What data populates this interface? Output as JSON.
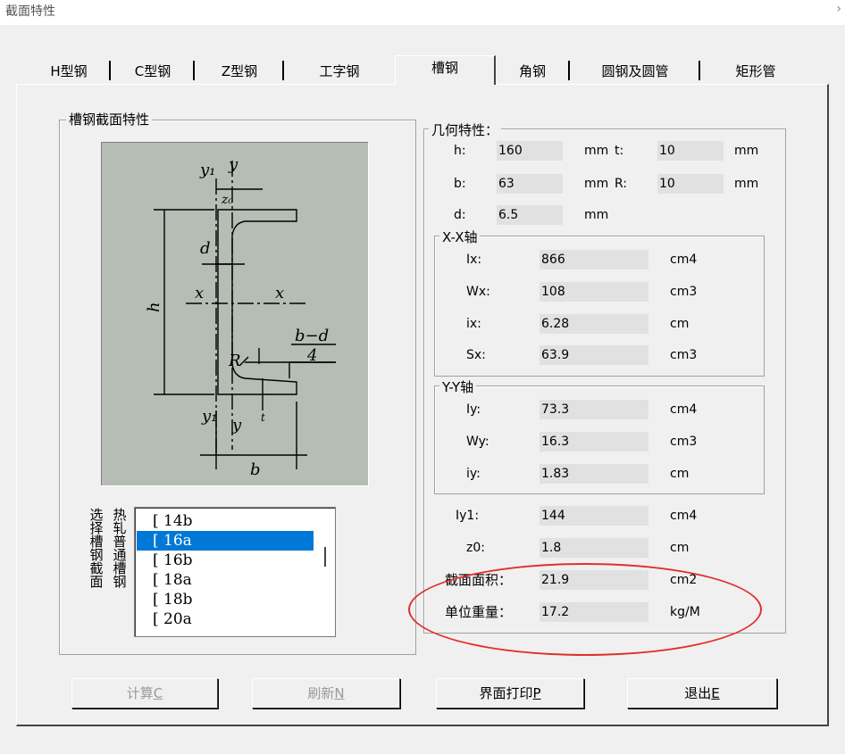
{
  "window": {
    "title": "截面特性",
    "close_glyph": "›"
  },
  "tabs": [
    {
      "label": "H型钢",
      "active": false
    },
    {
      "label": "C型钢",
      "active": false
    },
    {
      "label": "Z型钢",
      "active": false
    },
    {
      "label": "工字钢",
      "active": false
    },
    {
      "label": "槽钢",
      "active": true
    },
    {
      "label": "角钢",
      "active": false
    },
    {
      "label": "圆钢及圆管",
      "active": false
    },
    {
      "label": "矩形管",
      "active": false
    }
  ],
  "section_group": {
    "title": "槽钢截面特性"
  },
  "diagram": {
    "labels": {
      "y1_top": "y₁",
      "y_top": "y",
      "z0": "z₀",
      "d": "d",
      "x_left": "x",
      "x_right": "x",
      "h": "h",
      "bd_num": "b−d",
      "bd_den": "4",
      "R": "R",
      "y1_bottom": "y₁",
      "y_bottom": "y",
      "t": "t",
      "b": "b"
    }
  },
  "list_label": {
    "col1": "选择槽钢截面",
    "col2": "热轧普通槽钢"
  },
  "steel_list": {
    "items": [
      "[ 14b",
      "[ 16a",
      "[ 16b",
      "[ 18a",
      "[ 18b",
      "[ 20a"
    ],
    "selected_index": 1
  },
  "geometry": {
    "title": "几何特性：",
    "h": {
      "label": "h:",
      "value": "160",
      "unit": "mm"
    },
    "t": {
      "label": "t:",
      "value": "10",
      "unit": "mm"
    },
    "b": {
      "label": "b:",
      "value": "63",
      "unit": "mm"
    },
    "R": {
      "label": "R:",
      "value": "10",
      "unit": "mm"
    },
    "d": {
      "label": "d:",
      "value": "6.5",
      "unit": "mm"
    }
  },
  "xx_axis": {
    "title": "X-X轴",
    "rows": [
      {
        "label": "Ix:",
        "value": "866",
        "unit": "cm4"
      },
      {
        "label": "Wx:",
        "value": "108",
        "unit": "cm3"
      },
      {
        "label": "ix:",
        "value": "6.28",
        "unit": "cm"
      },
      {
        "label": "Sx:",
        "value": "63.9",
        "unit": "cm3"
      }
    ]
  },
  "yy_axis": {
    "title": "Y-Y轴",
    "rows": [
      {
        "label": "Iy:",
        "value": "73.3",
        "unit": "cm4"
      },
      {
        "label": "Wy:",
        "value": "16.3",
        "unit": "cm3"
      },
      {
        "label": "iy:",
        "value": "1.83",
        "unit": "cm"
      }
    ]
  },
  "other": {
    "rows": [
      {
        "label": "Iy1:",
        "value": "144",
        "unit": "cm4"
      },
      {
        "label": "z0:",
        "value": "1.8",
        "unit": "cm"
      },
      {
        "label": "截面面积：",
        "value": "21.9",
        "unit": "cm2"
      },
      {
        "label": "单位重量：",
        "value": "17.2",
        "unit": "kg/M"
      }
    ]
  },
  "buttons": {
    "calc": {
      "text": "计算",
      "key": "C"
    },
    "refresh": {
      "text": "刷新",
      "key": "N"
    },
    "print": {
      "text": "界面打印",
      "key": "P"
    },
    "exit": {
      "text": "退出",
      "key": "E"
    }
  },
  "colors": {
    "highlight": "#e0302a",
    "selection": "#0078d7",
    "diagram_bg": "#b5bdb5"
  }
}
